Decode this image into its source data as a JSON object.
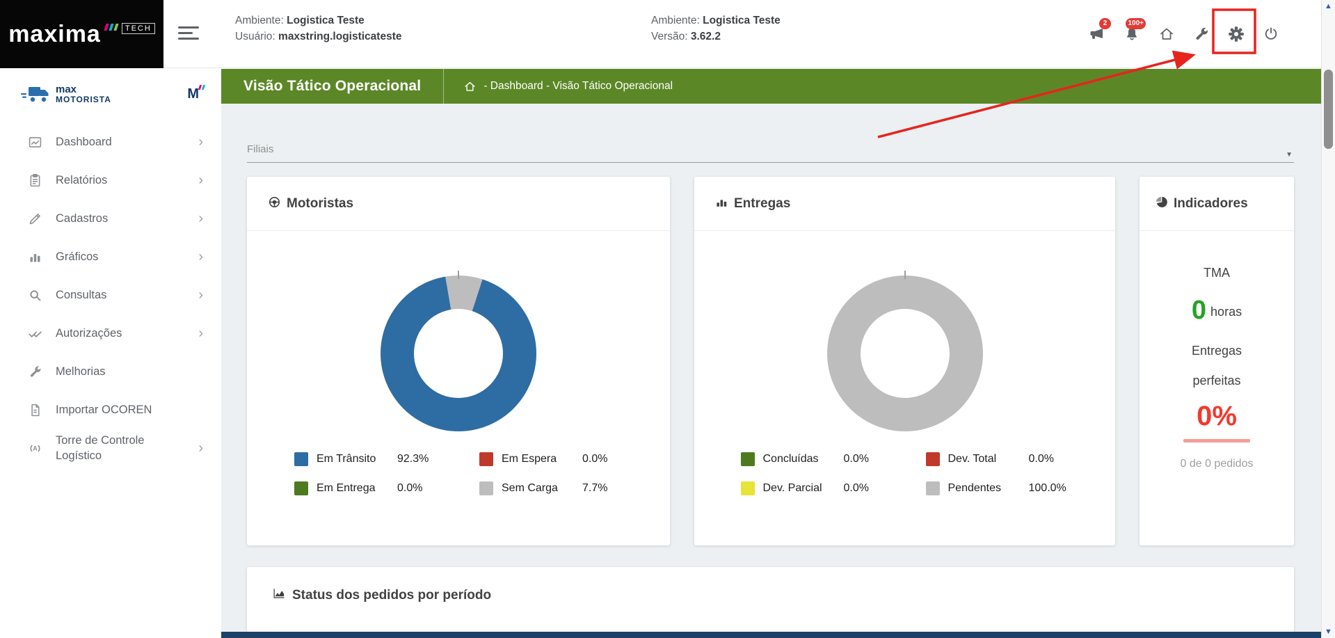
{
  "topbar": {
    "logo": {
      "brand": "maxima",
      "tech": "TECH"
    },
    "environment_left": {
      "ambiente_label": "Ambiente:",
      "ambiente_value": "Logistica Teste",
      "usuario_label": "Usuário:",
      "usuario_value": "maxstring.logisticateste"
    },
    "environment_center": {
      "ambiente_label": "Ambiente:",
      "ambiente_value": "Logistica Teste",
      "versao_label": "Versão:",
      "versao_value": "3.62.2"
    },
    "badges": {
      "megaphone_count": "2",
      "bell_count": "100+"
    }
  },
  "sidebar": {
    "logo": {
      "line1": "max",
      "line2": "MOTORISTA",
      "mini": "M"
    },
    "items": [
      {
        "label": "Dashboard"
      },
      {
        "label": "Relatórios"
      },
      {
        "label": "Cadastros"
      },
      {
        "label": "Gráficos"
      },
      {
        "label": "Consultas"
      },
      {
        "label": "Autorizações"
      },
      {
        "label": "Melhorias"
      },
      {
        "label": "Importar OCOREN"
      },
      {
        "label": "Torre de Controle Logístico"
      }
    ]
  },
  "page_header": {
    "title": "Visão Tático Operacional",
    "breadcrumb": "- Dashboard - Visão Tático Operacional"
  },
  "filters": {
    "filiais_label": "Filiais"
  },
  "cards": {
    "motoristas": {
      "title": "Motoristas",
      "legend": [
        {
          "label": "Em Trânsito",
          "value": "92.3%",
          "color": "#2e6da3"
        },
        {
          "label": "Em Espera",
          "value": "0.0%",
          "color": "#c0392b"
        },
        {
          "label": "Em Entrega",
          "value": "0.0%",
          "color": "#4d7a1f"
        },
        {
          "label": "Sem Carga",
          "value": "7.7%",
          "color": "#bdbdbd"
        }
      ]
    },
    "entregas": {
      "title": "Entregas",
      "legend": [
        {
          "label": "Concluídas",
          "value": "0.0%",
          "color": "#4d7a1f"
        },
        {
          "label": "Dev. Total",
          "value": "0.0%",
          "color": "#c0392b"
        },
        {
          "label": "Dev. Parcial",
          "value": "0.0%",
          "color": "#e8e337"
        },
        {
          "label": "Pendentes",
          "value": "100.0%",
          "color": "#bdbdbd"
        }
      ]
    },
    "indicadores": {
      "title": "Indicadores",
      "tma_label": "TMA",
      "tma_value": "0",
      "tma_unit": "horas",
      "metric_line1": "Entregas",
      "metric_line2": "perfeitas",
      "metric_percent": "0%",
      "metric_footer": "0 de 0 pedidos"
    },
    "status_pedidos": {
      "title": "Status dos pedidos por período"
    }
  },
  "chart_data": [
    {
      "type": "pie",
      "title": "Motoristas",
      "labels": [
        "Em Trânsito",
        "Em Espera",
        "Em Entrega",
        "Sem Carga"
      ],
      "values": [
        92.3,
        0.0,
        0.0,
        7.7
      ],
      "colors": [
        "#2e6da3",
        "#c0392b",
        "#4d7a1f",
        "#bdbdbd"
      ],
      "donut": true,
      "start_angle": 18,
      "legend_position": "bottom"
    },
    {
      "type": "pie",
      "title": "Entregas",
      "labels": [
        "Concluídas",
        "Dev. Total",
        "Dev. Parcial",
        "Pendentes"
      ],
      "values": [
        0.0,
        0.0,
        0.0,
        100.0
      ],
      "colors": [
        "#4d7a1f",
        "#c0392b",
        "#e8e337",
        "#bdbdbd"
      ],
      "donut": true,
      "start_angle": 0,
      "legend_position": "bottom"
    }
  ],
  "annotation": {
    "color": "#e8231e"
  },
  "colors": {
    "header_green": "#5c8727",
    "positive_green": "#22a322",
    "alert_red": "#f3392e",
    "badge_red": "#e53935"
  }
}
